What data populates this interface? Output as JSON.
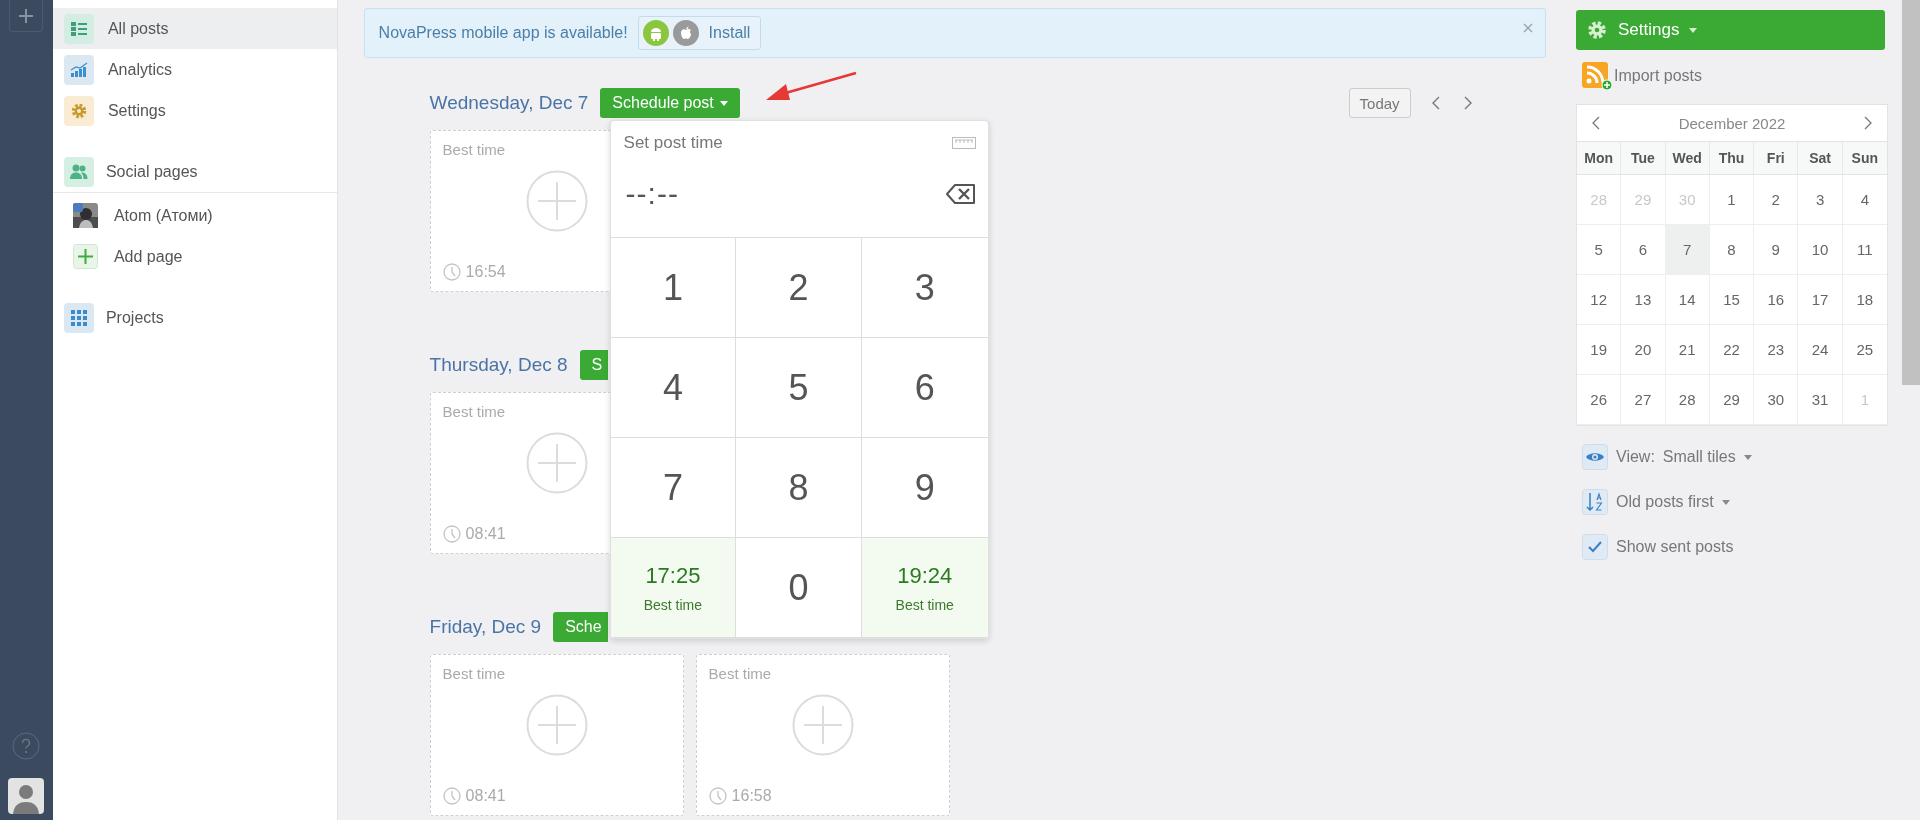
{
  "sidebar": {
    "items": [
      {
        "kind": "nav",
        "label": "All posts",
        "selected": true
      },
      {
        "kind": "nav",
        "label": "Analytics",
        "selected": false
      },
      {
        "kind": "nav",
        "label": "Settings",
        "selected": false
      },
      {
        "kind": "section",
        "label": "Social pages",
        "selected": false
      },
      {
        "kind": "page",
        "label": "Atom (Атоми)",
        "selected": false
      },
      {
        "kind": "add",
        "label": "Add page",
        "selected": false
      },
      {
        "kind": "section",
        "label": "Projects",
        "selected": false
      }
    ]
  },
  "banner": {
    "text": "NovaPress mobile app is available!",
    "install": "Install"
  },
  "nav": {
    "today": "Today"
  },
  "days": [
    {
      "heading": "Wednesday, Dec 7",
      "button": "Schedule post",
      "dropdown": true,
      "tiles": [
        {
          "label": "Best time",
          "time": "16:54"
        }
      ]
    },
    {
      "heading": "Thursday, Dec 8",
      "button": "S",
      "dropdown": false,
      "tiles": [
        {
          "label": "Best time",
          "time": "08:41"
        }
      ]
    },
    {
      "heading": "Friday, Dec 9",
      "button": "Sche",
      "dropdown": false,
      "tiles": [
        {
          "label": "Best time",
          "time": "08:41"
        },
        {
          "label": "Best time",
          "time": "16:58"
        }
      ]
    }
  ],
  "popup": {
    "title": "Set post time",
    "value": "--:--",
    "keys": [
      {
        "kind": "digit",
        "text": "1"
      },
      {
        "kind": "digit",
        "text": "2"
      },
      {
        "kind": "digit",
        "text": "3"
      },
      {
        "kind": "digit",
        "text": "4"
      },
      {
        "kind": "digit",
        "text": "5"
      },
      {
        "kind": "digit",
        "text": "6"
      },
      {
        "kind": "digit",
        "text": "7"
      },
      {
        "kind": "digit",
        "text": "8"
      },
      {
        "kind": "digit",
        "text": "9"
      },
      {
        "kind": "best",
        "text": "17:25",
        "label": "Best time"
      },
      {
        "kind": "digit",
        "text": "0"
      },
      {
        "kind": "best",
        "text": "19:24",
        "label": "Best time"
      }
    ]
  },
  "right": {
    "settings": "Settings",
    "import": "Import posts",
    "calendar": {
      "title": "December 2022",
      "weekdays": [
        "Mon",
        "Tue",
        "Wed",
        "Thu",
        "Fri",
        "Sat",
        "Sun"
      ],
      "weeks": [
        [
          {
            "day": "28",
            "muted": true,
            "selected": false
          },
          {
            "day": "29",
            "muted": true,
            "selected": false
          },
          {
            "day": "30",
            "muted": true,
            "selected": false
          },
          {
            "day": "1",
            "muted": false,
            "selected": false
          },
          {
            "day": "2",
            "muted": false,
            "selected": false
          },
          {
            "day": "3",
            "muted": false,
            "selected": false
          },
          {
            "day": "4",
            "muted": false,
            "selected": false
          }
        ],
        [
          {
            "day": "5",
            "muted": false,
            "selected": false
          },
          {
            "day": "6",
            "muted": false,
            "selected": false
          },
          {
            "day": "7",
            "muted": false,
            "selected": true
          },
          {
            "day": "8",
            "muted": false,
            "selected": false
          },
          {
            "day": "9",
            "muted": false,
            "selected": false
          },
          {
            "day": "10",
            "muted": false,
            "selected": false
          },
          {
            "day": "11",
            "muted": false,
            "selected": false
          }
        ],
        [
          {
            "day": "12",
            "muted": false,
            "selected": false
          },
          {
            "day": "13",
            "muted": false,
            "selected": false
          },
          {
            "day": "14",
            "muted": false,
            "selected": false
          },
          {
            "day": "15",
            "muted": false,
            "selected": false
          },
          {
            "day": "16",
            "muted": false,
            "selected": false
          },
          {
            "day": "17",
            "muted": false,
            "selected": false
          },
          {
            "day": "18",
            "muted": false,
            "selected": false
          }
        ],
        [
          {
            "day": "19",
            "muted": false,
            "selected": false
          },
          {
            "day": "20",
            "muted": false,
            "selected": false
          },
          {
            "day": "21",
            "muted": false,
            "selected": false
          },
          {
            "day": "22",
            "muted": false,
            "selected": false
          },
          {
            "day": "23",
            "muted": false,
            "selected": false
          },
          {
            "day": "24",
            "muted": false,
            "selected": false
          },
          {
            "day": "25",
            "muted": false,
            "selected": false
          }
        ],
        [
          {
            "day": "26",
            "muted": false,
            "selected": false
          },
          {
            "day": "27",
            "muted": false,
            "selected": false
          },
          {
            "day": "28",
            "muted": false,
            "selected": false
          },
          {
            "day": "29",
            "muted": false,
            "selected": false
          },
          {
            "day": "30",
            "muted": false,
            "selected": false
          },
          {
            "day": "31",
            "muted": false,
            "selected": false
          },
          {
            "day": "1",
            "muted": true,
            "selected": false
          }
        ]
      ]
    },
    "options": [
      {
        "kind": "dropdown",
        "label": "View:",
        "value": "Small tiles"
      },
      {
        "kind": "dropdown",
        "label": "Old posts first"
      },
      {
        "kind": "checkbox",
        "label": "Show sent posts",
        "checked": true
      }
    ]
  }
}
